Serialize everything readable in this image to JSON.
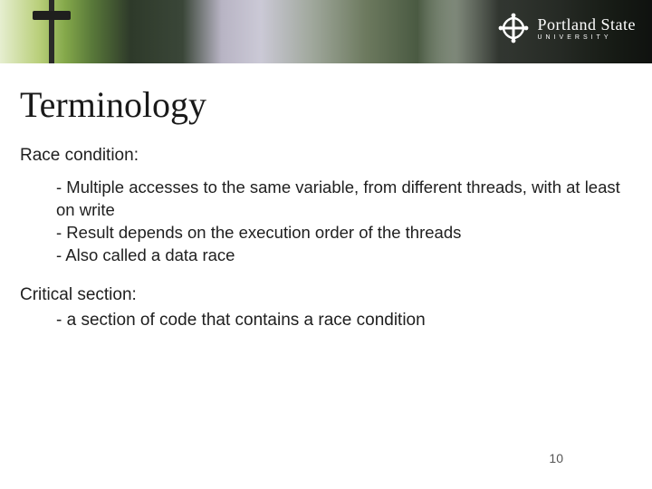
{
  "logo": {
    "line1": "Portland State",
    "line2": "UNIVERSITY"
  },
  "title": "Terminology",
  "section1": {
    "label": "Race condition:",
    "items": [
      "- Multiple accesses to the same variable, from different threads, with at least on write",
      "- Result depends on the execution order of the threads",
      "- Also called a data race"
    ]
  },
  "section2": {
    "label": "Critical section:",
    "items": [
      "-  a section of code that contains a race condition"
    ]
  },
  "page_number": "10"
}
